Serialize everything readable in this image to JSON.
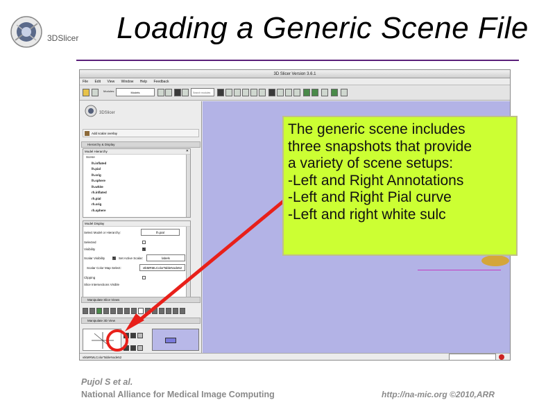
{
  "slide": {
    "title": "Loading a Generic Scene File",
    "logo_text": "3DSlicer",
    "footer_author": "Pujol S et al.",
    "footer_org": "National Alliance for Medical Image Computing",
    "footer_url": "http://na-mic.org",
    "footer_copyright": "©2010,ARR"
  },
  "app": {
    "window_title": "3D Slicer Version 3.6.1",
    "menu": [
      "File",
      "Edit",
      "View",
      "Window",
      "Help",
      "Feedback"
    ],
    "toolbar": {
      "modules_label": "Modules:",
      "module_selected": "Models",
      "search_placeholder": "Search modules"
    },
    "panel_logo_text": "3DSlicer",
    "add_overlay_label": "Add scalar overlay",
    "hierarchy_section": "Hierarchy & Display",
    "model_hierarchy": {
      "title": "Model Hierarchy",
      "root": "Scene",
      "items": [
        "lh.inflated",
        "lh.pial",
        "lh.orig",
        "lh.sphere",
        "lh.white",
        "rh.inflated",
        "rh.pial",
        "rh.orig",
        "rh.sphere"
      ]
    },
    "model_display": {
      "title": "Model Display",
      "select_label": "Select Model or Hierarchy:",
      "select_value": "lh.pial",
      "selected_label": "Selected",
      "visibility_label": "Visibility",
      "scalar_visibility_label": "Scalar Visibility",
      "set_active_scalar_label": "Set Active Scalar:",
      "active_scalar_value": "labels",
      "color_map_label": "Scalar Color Map Select:",
      "color_map_value": "vtkMRMLColorTableNode52",
      "clipping_label": "Clipping",
      "slice_intersections_label": "Slice Intersections Visible"
    },
    "manipulate_slice_views": "Manipulate Slice Views",
    "manipulate_3d_view": "Manipulate 3D View",
    "status_text": "vtkMRMLColorTableNode52"
  },
  "callout": {
    "lines": [
      "The generic scene includes",
      "three snapshots that provide",
      "a variety of scene setups:",
      "-Left and Right Annotations",
      "-Left and Right Pial curve",
      "-Left and right white sulc"
    ]
  },
  "colors": {
    "callout_bg": "#ccff33",
    "arrow": "#e8201a",
    "view_bg": "#b3b3e6",
    "title_rule": "#5a1f7a"
  }
}
